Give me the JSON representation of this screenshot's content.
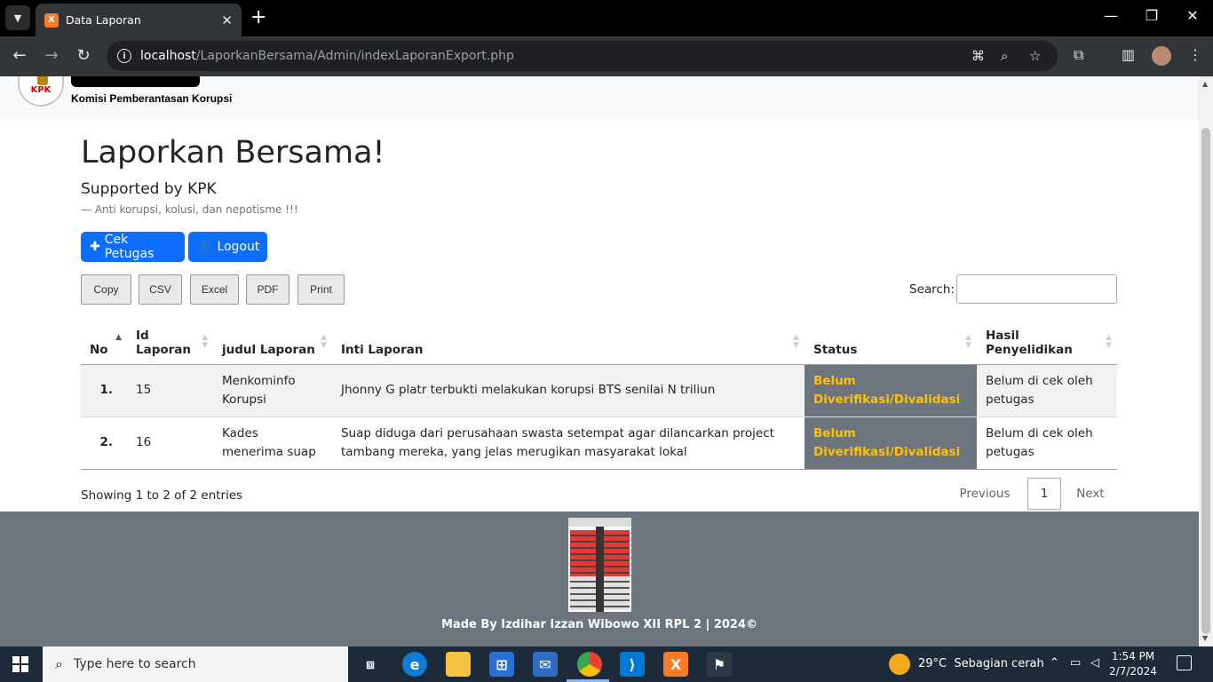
{
  "browser": {
    "tab_title": "Data Laporan",
    "tab_favicon": "xampp-icon",
    "url_host": "localhost",
    "url_path": "/LaporkanBersama/Admin/indexLaporanExport.php"
  },
  "navbar": {
    "logo_mini": "KPK",
    "logo_text": "Komisi Pemberantasan Korupsi"
  },
  "header": {
    "title": "Laporkan Bersama!",
    "subtitle": "Supported by KPK",
    "quote": "— Anti korupsi, kolusi, dan nepotisme !!!"
  },
  "actions": {
    "cek_petugas": "Cek Petugas",
    "logout": "Logout"
  },
  "datatable": {
    "buttons": [
      "Copy",
      "CSV",
      "Excel",
      "PDF",
      "Print"
    ],
    "search_label": "Search:",
    "search_value": "",
    "columns": {
      "no": "No",
      "id_line1": "Id",
      "id_line2": "Laporan",
      "judul": "judul Laporan",
      "inti": "Inti Laporan",
      "status": "Status",
      "hasil": "Hasil Penyelidikan"
    },
    "rows": [
      {
        "no": "1.",
        "id": "15",
        "judul": "Menkominfo Korupsi",
        "inti": "Jhonny G platr terbukti melakukan korupsi BTS senilai N triliun",
        "status": "Belum Diverifikasi/Divalidasi",
        "hasil": "Belum di cek oleh petugas"
      },
      {
        "no": "2.",
        "id": "16",
        "judul": "Kades menerima suap",
        "inti": "Suap diduga dari perusahaan swasta setempat agar dilancarkan project tambang mereka, yang jelas merugikan masyarakat lokal",
        "status": "Belum Diverifikasi/Divalidasi",
        "hasil": "Belum di cek oleh petugas"
      }
    ],
    "info": "Showing 1 to 2 of 2 entries",
    "pagination": {
      "previous": "Previous",
      "current": "1",
      "next": "Next"
    }
  },
  "footer": {
    "text": "Made By Izdihar Izzan Wibowo XII RPL 2 | 2024©"
  },
  "taskbar": {
    "search_placeholder": "Type here to search",
    "temperature": "29°C",
    "weather": "Sebagian cerah",
    "time": "1:54 PM",
    "date": "2/7/2024"
  },
  "colors": {
    "primary": "#0d6efd",
    "status_bg": "#6c757d",
    "status_text": "#ffc107",
    "footer_bg": "#6c757d"
  }
}
